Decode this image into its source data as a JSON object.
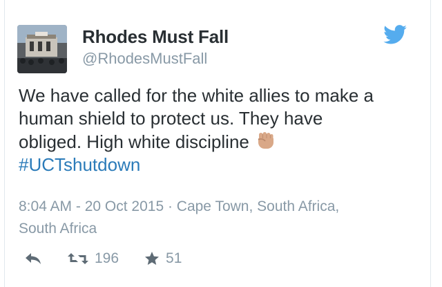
{
  "tweet": {
    "author_name": "Rhodes Must Fall",
    "author_handle": "@RhodesMustFall",
    "text_lines": [
      "We have called for the white allies to make a",
      "human shield to protect us. They have",
      "obliged. High white discipline"
    ],
    "emoji": "raised-fist-medium-light-skin-tone",
    "hashtag": "#UCTshutdown",
    "meta_line_1": "8:04 AM - 20 Oct 2015 · Cape Town, South Africa,",
    "meta_line_2": "South Africa",
    "retweet_count": "196",
    "favorite_count": "51"
  },
  "icons": {
    "brand": "twitter-bird-icon",
    "reply": "reply-icon",
    "retweet": "retweet-icon",
    "favorite": "star-icon"
  },
  "colors": {
    "twitter_blue": "#55acee",
    "link_blue": "#2b7bb9",
    "text": "#292f33",
    "muted": "#8899a6",
    "fist_skin": "#d9a888"
  }
}
